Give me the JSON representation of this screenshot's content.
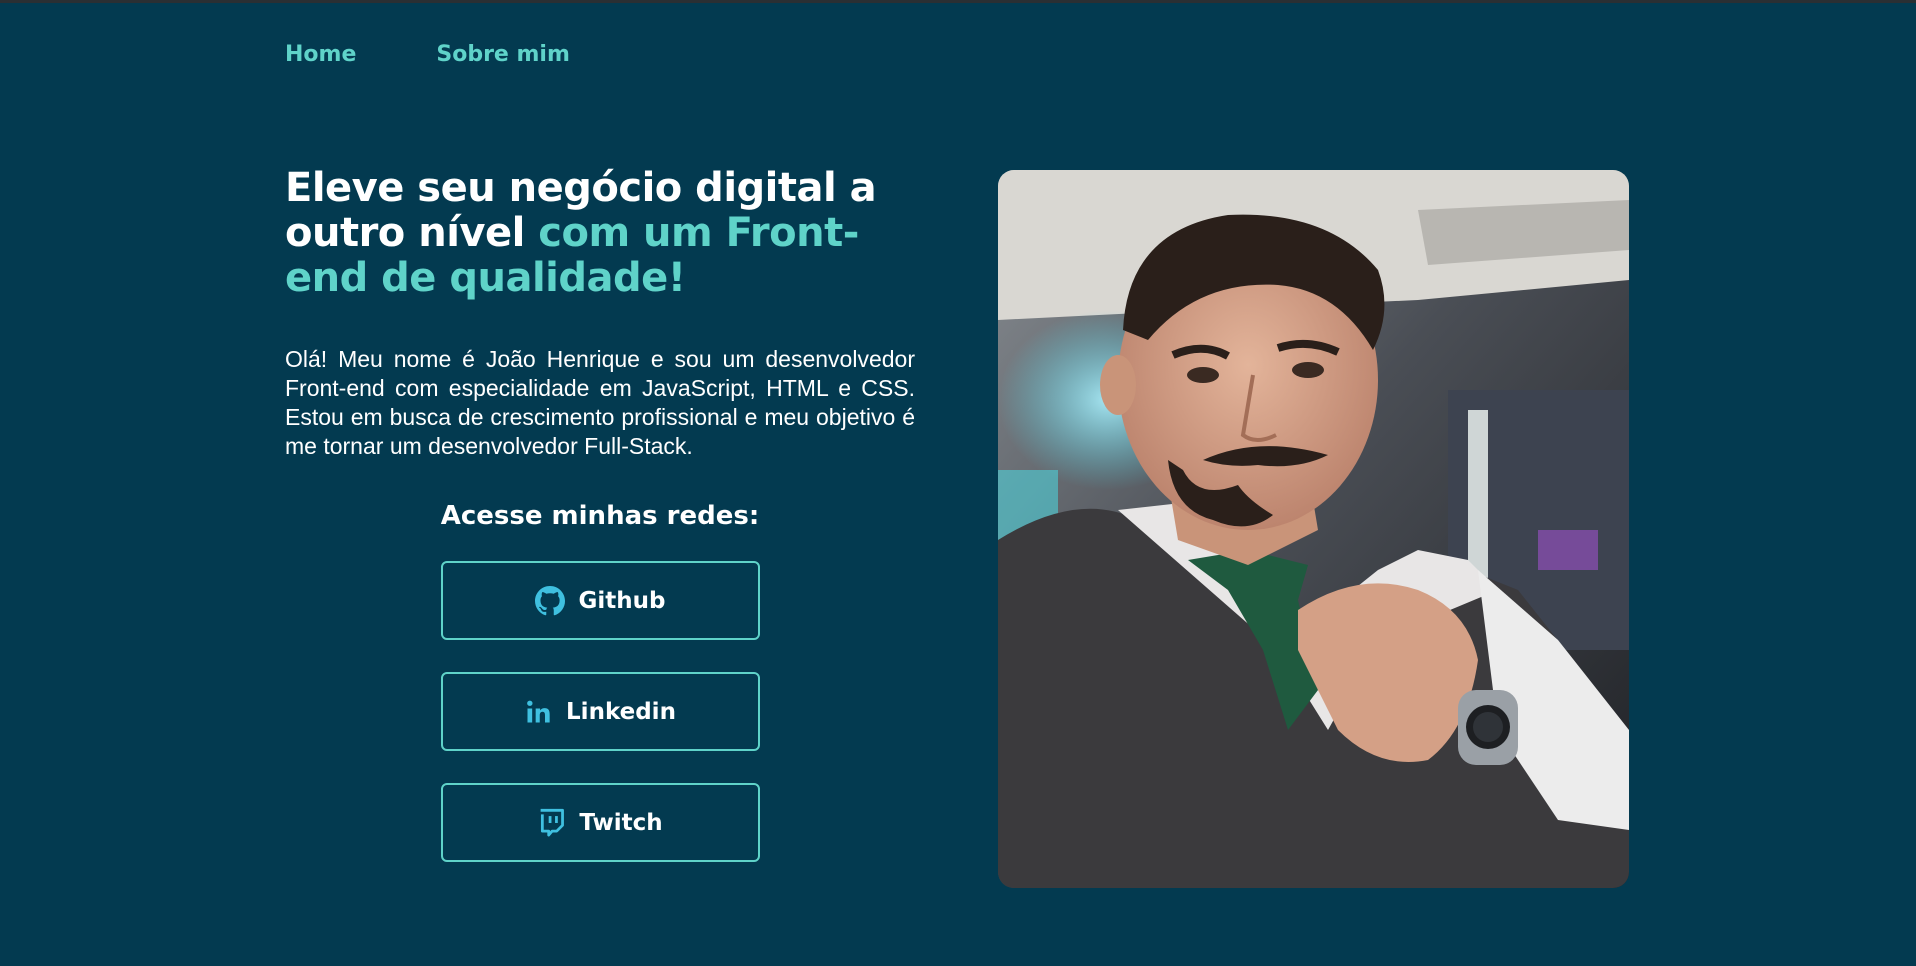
{
  "nav": {
    "home": "Home",
    "about": "Sobre mim"
  },
  "hero": {
    "headline_part1": "Eleve seu negócio digital a outro nível ",
    "headline_part2": "com um Front-end de qualidade!",
    "intro": "Olá! Meu nome é João Henrique e sou um desenvolvedor Front-end com especialidade em JavaScript, HTML e CSS. Estou em busca de crescimento profissional e meu objetivo é me tornar um desenvolvedor Full-Stack."
  },
  "social": {
    "title": "Acesse minhas redes:",
    "buttons": [
      {
        "label": "Github",
        "icon": "github-icon"
      },
      {
        "label": "Linkedin",
        "icon": "linkedin-icon"
      },
      {
        "label": "Twitch",
        "icon": "twitch-icon"
      }
    ]
  },
  "colors": {
    "background": "#033a50",
    "accent": "#5fd3c9",
    "text": "#ffffff",
    "icon": "#3fc0e0"
  },
  "photo": {
    "subject": "profile-photo"
  }
}
